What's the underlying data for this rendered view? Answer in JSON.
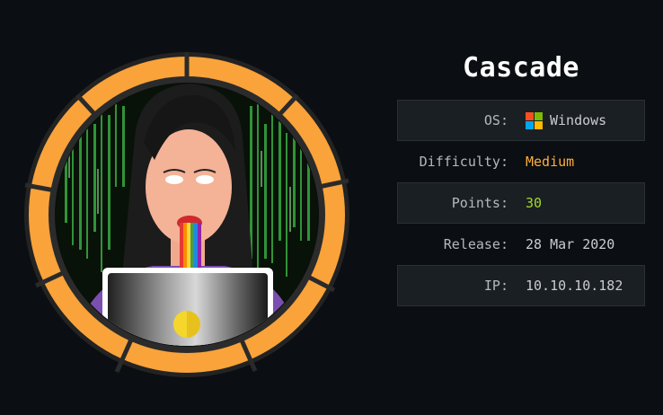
{
  "machine": {
    "name": "Cascade"
  },
  "info": [
    {
      "label": "OS:",
      "value": "Windows",
      "icon": "windows-icon"
    },
    {
      "label": "Difficulty:",
      "value": "Medium"
    },
    {
      "label": "Points:",
      "value": "30"
    },
    {
      "label": "Release:",
      "value": "28 Mar 2020"
    },
    {
      "label": "IP:",
      "value": "10.10.10.182"
    }
  ],
  "colors": {
    "background": "#0b0e12",
    "ring": "#f9a33a",
    "difficulty_medium": "#ffaf3a",
    "points": "#a1d82a",
    "table_row_shaded": "#1a1f24"
  }
}
